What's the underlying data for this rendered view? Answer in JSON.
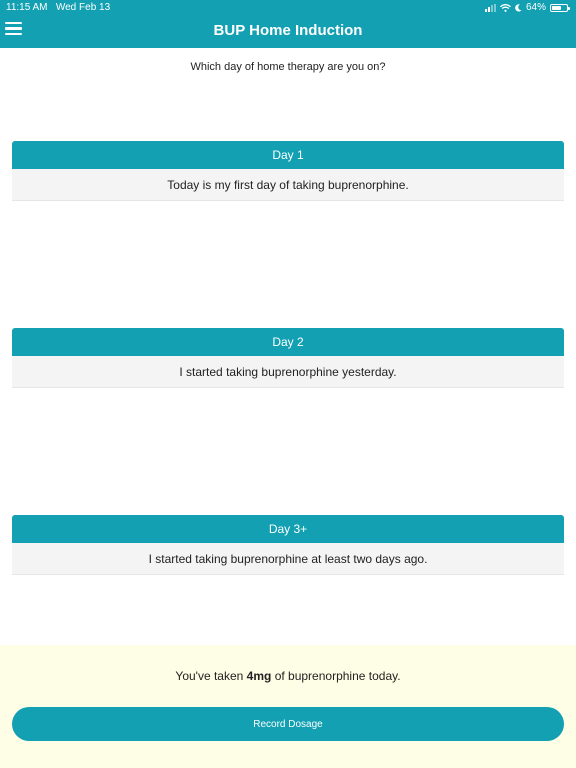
{
  "status_bar": {
    "time": "11:15 AM",
    "date": "Wed Feb 13",
    "battery_text": "64%",
    "battery_level": 0.64
  },
  "header": {
    "title": "BUP Home Induction",
    "menu_icon": "hamburger-icon",
    "color": "#12a0b2"
  },
  "main": {
    "question": "Which day of home therapy are you on?",
    "options": [
      {
        "title": "Day 1",
        "description": "Today is my first day of taking buprenorphine."
      },
      {
        "title": "Day 2",
        "description": "I started taking buprenorphine yesterday."
      },
      {
        "title": "Day 3+",
        "description": "I started taking buprenorphine at least two days ago."
      }
    ]
  },
  "footer": {
    "taken_prefix": "You've taken ",
    "taken_amount": "4mg",
    "taken_suffix": " of buprenorphine today.",
    "record_button": "Record Dosage",
    "background": "#fefee6"
  }
}
